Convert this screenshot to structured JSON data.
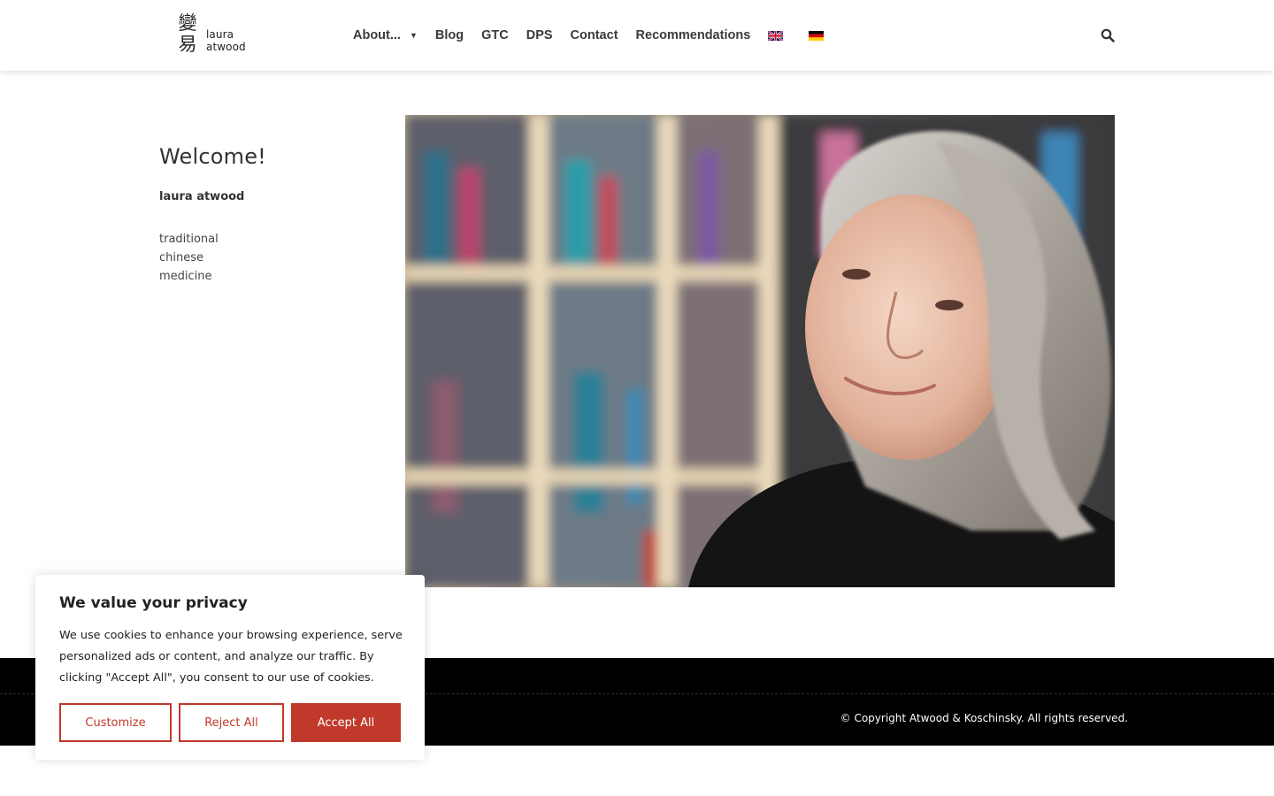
{
  "header": {
    "logo_glyph_top": "變",
    "logo_glyph_bottom": "易",
    "logo_text": "laura atwood",
    "nav": [
      {
        "label": "About..."
      },
      {
        "label": "Blog"
      },
      {
        "label": "GTC"
      },
      {
        "label": "DPS"
      },
      {
        "label": "Contact"
      },
      {
        "label": "Recommendations"
      }
    ],
    "flags": [
      "english-flag",
      "german-flag"
    ],
    "search_icon": "search-icon"
  },
  "hero": {
    "title": "Welcome!",
    "name": "laura atwood",
    "tagline": [
      "traditional",
      "chinese",
      "medicine"
    ]
  },
  "footer": {
    "copyright": "© Copyright Atwood & Koschinsky. All rights reserved."
  },
  "cookie_banner": {
    "title": "We value your privacy",
    "text": "We use cookies to enhance your browsing experience, serve personalized ads or content, and analyze our traffic. By clicking \"Accept All\", you consent to our use of cookies.",
    "customize_label": "Customize",
    "reject_label": "Reject All",
    "accept_label": "Accept All"
  },
  "colors": {
    "accent": "#c0392b",
    "footer_bg": "#000000",
    "text": "#333333"
  }
}
